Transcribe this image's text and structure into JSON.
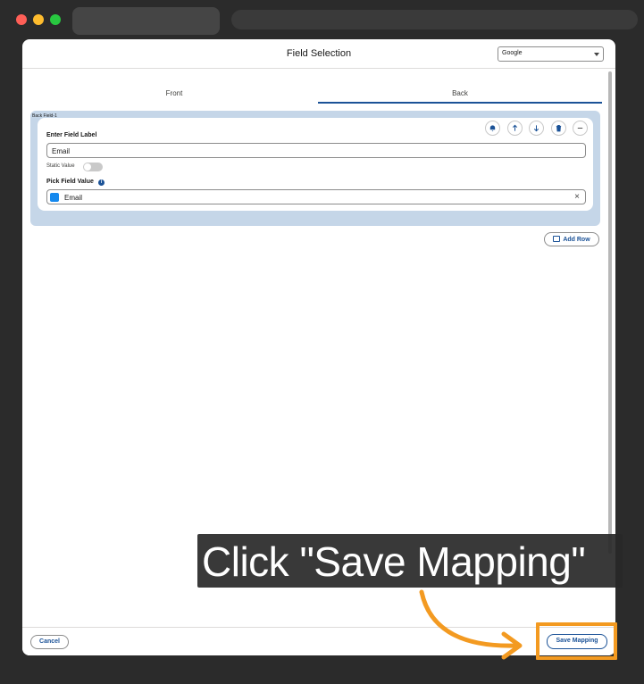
{
  "modal": {
    "title": "Field Selection",
    "provider_select": {
      "value": "Google"
    }
  },
  "tabs": [
    {
      "label": "Front",
      "selected": false
    },
    {
      "label": "Back",
      "selected": true
    }
  ],
  "field_card": {
    "tag": "Back Field-1",
    "label_heading": "Enter Field Label",
    "label_value": "Email",
    "static_value_label": "Static Value",
    "static_value_on": false,
    "pick_heading": "Pick Field Value",
    "pick_value": "Email",
    "clear_glyph": "×",
    "actions": [
      "bell-icon",
      "arrow-up-icon",
      "arrow-down-icon",
      "trash-icon",
      "minus-icon"
    ]
  },
  "buttons": {
    "add_row": "Add Row",
    "cancel": "Cancel",
    "save": "Save Mapping"
  },
  "annotation": {
    "text": "Click \"Save Mapping\"",
    "highlight_color": "#f39a21"
  },
  "colors": {
    "accent": "#1b5297",
    "card_bg": "#c5d6e8"
  }
}
